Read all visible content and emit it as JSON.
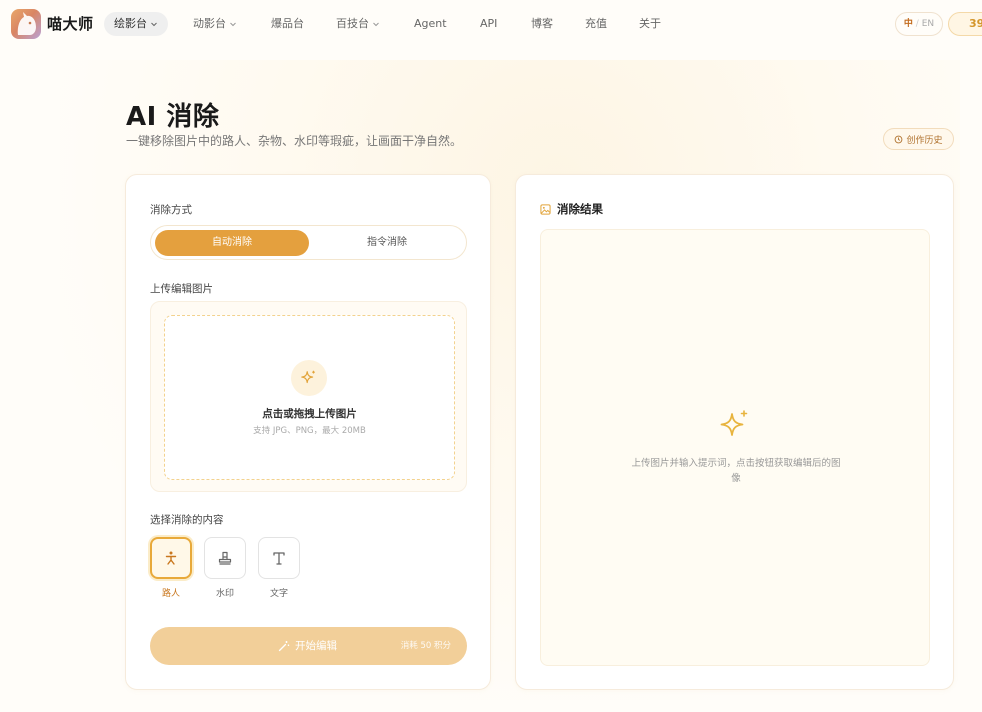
{
  "brand": {
    "name": "喵大师"
  },
  "nav": {
    "items": [
      {
        "label": "绘影台",
        "has_dropdown": true,
        "active": true
      },
      {
        "label": "动影台",
        "has_dropdown": true,
        "active": false
      },
      {
        "label": "爆品台",
        "has_dropdown": false,
        "active": false
      },
      {
        "label": "百技台",
        "has_dropdown": true,
        "active": false
      },
      {
        "label": "Agent",
        "has_dropdown": false,
        "active": false
      },
      {
        "label": "API",
        "has_dropdown": false,
        "active": false
      },
      {
        "label": "博客",
        "has_dropdown": false,
        "active": false
      },
      {
        "label": "充值",
        "has_dropdown": false,
        "active": false
      },
      {
        "label": "关于",
        "has_dropdown": false,
        "active": false
      }
    ],
    "lang": {
      "zh": "中",
      "sep": "/",
      "en": "EN"
    },
    "points": "39"
  },
  "header": {
    "title": "AI 消除",
    "subtitle": "一键移除图片中的路人、杂物、水印等瑕疵，让画面干净自然。",
    "history_label": "创作历史"
  },
  "left": {
    "mode_label": "消除方式",
    "modes": [
      {
        "label": "自动消除",
        "selected": true
      },
      {
        "label": "指令消除",
        "selected": false
      }
    ],
    "upload_label": "上传编辑图片",
    "upload": {
      "title": "点击或拖拽上传图片",
      "hint": "支持 JPG、PNG，最大 20MB"
    },
    "content_label": "选择消除的内容",
    "options": [
      {
        "label": "路人",
        "icon": "person-icon",
        "selected": true
      },
      {
        "label": "水印",
        "icon": "stamp-icon",
        "selected": false
      },
      {
        "label": "文字",
        "icon": "text-icon",
        "selected": false
      }
    ],
    "start": {
      "label": "开始编辑",
      "cost": "消耗 50 积分"
    }
  },
  "right": {
    "title": "消除结果",
    "hint": "上传图片并输入提示词，点击按钮获取编辑后的图像"
  },
  "colors": {
    "accent": "#e4a03e",
    "accent_light": "#f2cf99",
    "accent_text": "#c9771e"
  }
}
